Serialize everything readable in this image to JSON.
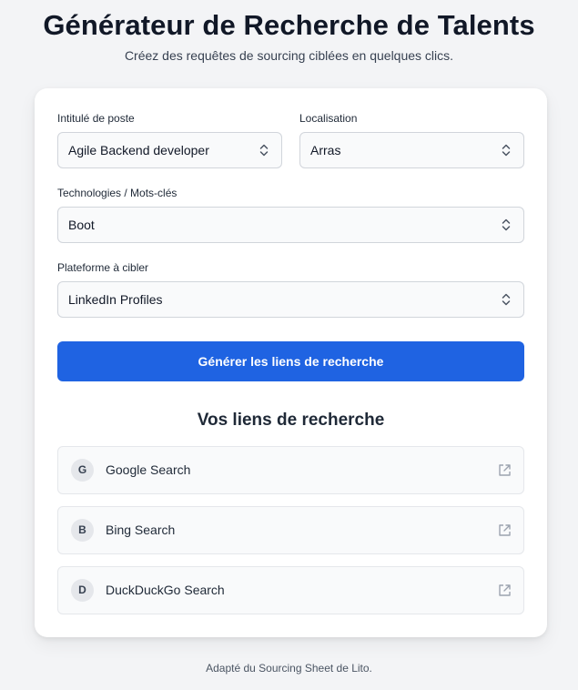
{
  "header": {
    "title": "Générateur de Recherche de Talents",
    "subtitle": "Créez des requêtes de sourcing ciblées en quelques clics."
  },
  "form": {
    "job_title": {
      "label": "Intitulé de poste",
      "value": "Agile Backend developer"
    },
    "location": {
      "label": "Localisation",
      "value": "Arras"
    },
    "keywords": {
      "label": "Technologies / Mots-clés",
      "value": "Boot"
    },
    "platform": {
      "label": "Plateforme à cibler",
      "value": "LinkedIn Profiles"
    },
    "generate_label": "Générer les liens de recherche"
  },
  "results": {
    "title": "Vos liens de recherche",
    "links": [
      {
        "badge": "G",
        "label": "Google Search",
        "icon": "external-link-icon"
      },
      {
        "badge": "B",
        "label": "Bing Search",
        "icon": "external-link-icon"
      },
      {
        "badge": "D",
        "label": "DuckDuckGo Search",
        "icon": "external-link-icon"
      }
    ]
  },
  "footer": {
    "text": "Adapté du Sourcing Sheet de Lito."
  },
  "colors": {
    "accent": "#1f63e2",
    "background": "#f3f4f6",
    "card": "#ffffff",
    "field_background": "#f9fafb",
    "border": "#d1d5db"
  }
}
